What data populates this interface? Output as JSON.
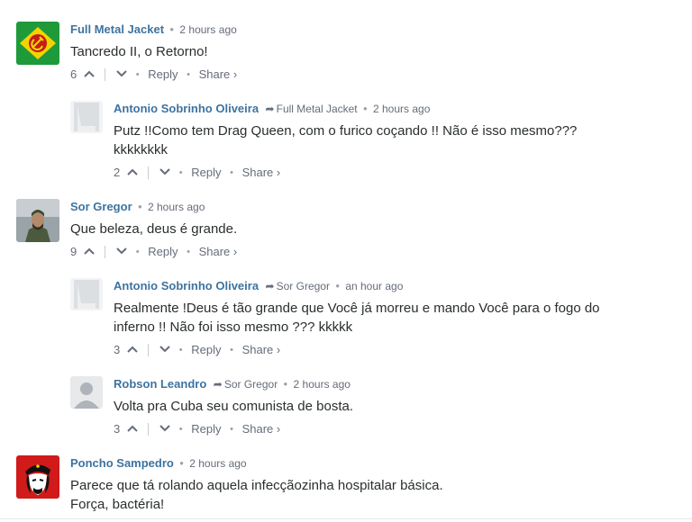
{
  "comments": [
    {
      "author": "Full Metal Jacket",
      "time": "2 hours ago",
      "text_lines": [
        "Tancredo II, o Retorno!"
      ],
      "votes": "6",
      "reply_label": "Reply",
      "share_label": "Share ›"
    },
    {
      "author": "Antonio Sobrinho Oliveira",
      "parent": "Full Metal Jacket",
      "time": "2 hours ago",
      "text_lines": [
        "Putz !!Como tem Drag Queen, com o furico coçando !! Não é isso mesmo???",
        "kkkkkkkk"
      ],
      "votes": "2",
      "reply_label": "Reply",
      "share_label": "Share ›"
    },
    {
      "author": "Sor Gregor",
      "time": "2 hours ago",
      "text_lines": [
        "Que beleza, deus é grande."
      ],
      "votes": "9",
      "reply_label": "Reply",
      "share_label": "Share ›"
    },
    {
      "author": "Antonio Sobrinho Oliveira",
      "parent": "Sor Gregor",
      "time": "an hour ago",
      "text_lines": [
        "Realmente !Deus é tão grande que Você já morreu e mando Você para o fogo do",
        "inferno !! Não foi isso mesmo ??? kkkkk"
      ],
      "votes": "3",
      "reply_label": "Reply",
      "share_label": "Share ›"
    },
    {
      "author": "Robson Leandro",
      "parent": "Sor Gregor",
      "time": "2 hours ago",
      "text_lines": [
        "Volta pra Cuba seu comunista de bosta."
      ],
      "votes": "3",
      "reply_label": "Reply",
      "share_label": "Share ›"
    },
    {
      "author": "Poncho Sampedro",
      "time": "2 hours ago",
      "text_lines": [
        "Parece que tá rolando aquela infecçãozinha hospitalar básica.",
        "Força, bactéria!"
      ]
    }
  ],
  "glyphs": {
    "up": "^",
    "down": "v",
    "arrow": "➦",
    "bullet": "•"
  },
  "colors": {
    "author": "#3d73a0",
    "meta": "#656c7a",
    "text": "#2a2e2e"
  },
  "icons": [
    "brazil-soviet-flag-avatar",
    "placeholder-user-avatar",
    "military-portrait-avatar",
    "placeholder-user-avatar",
    "default-user-avatar",
    "che-guevara-avatar"
  ]
}
